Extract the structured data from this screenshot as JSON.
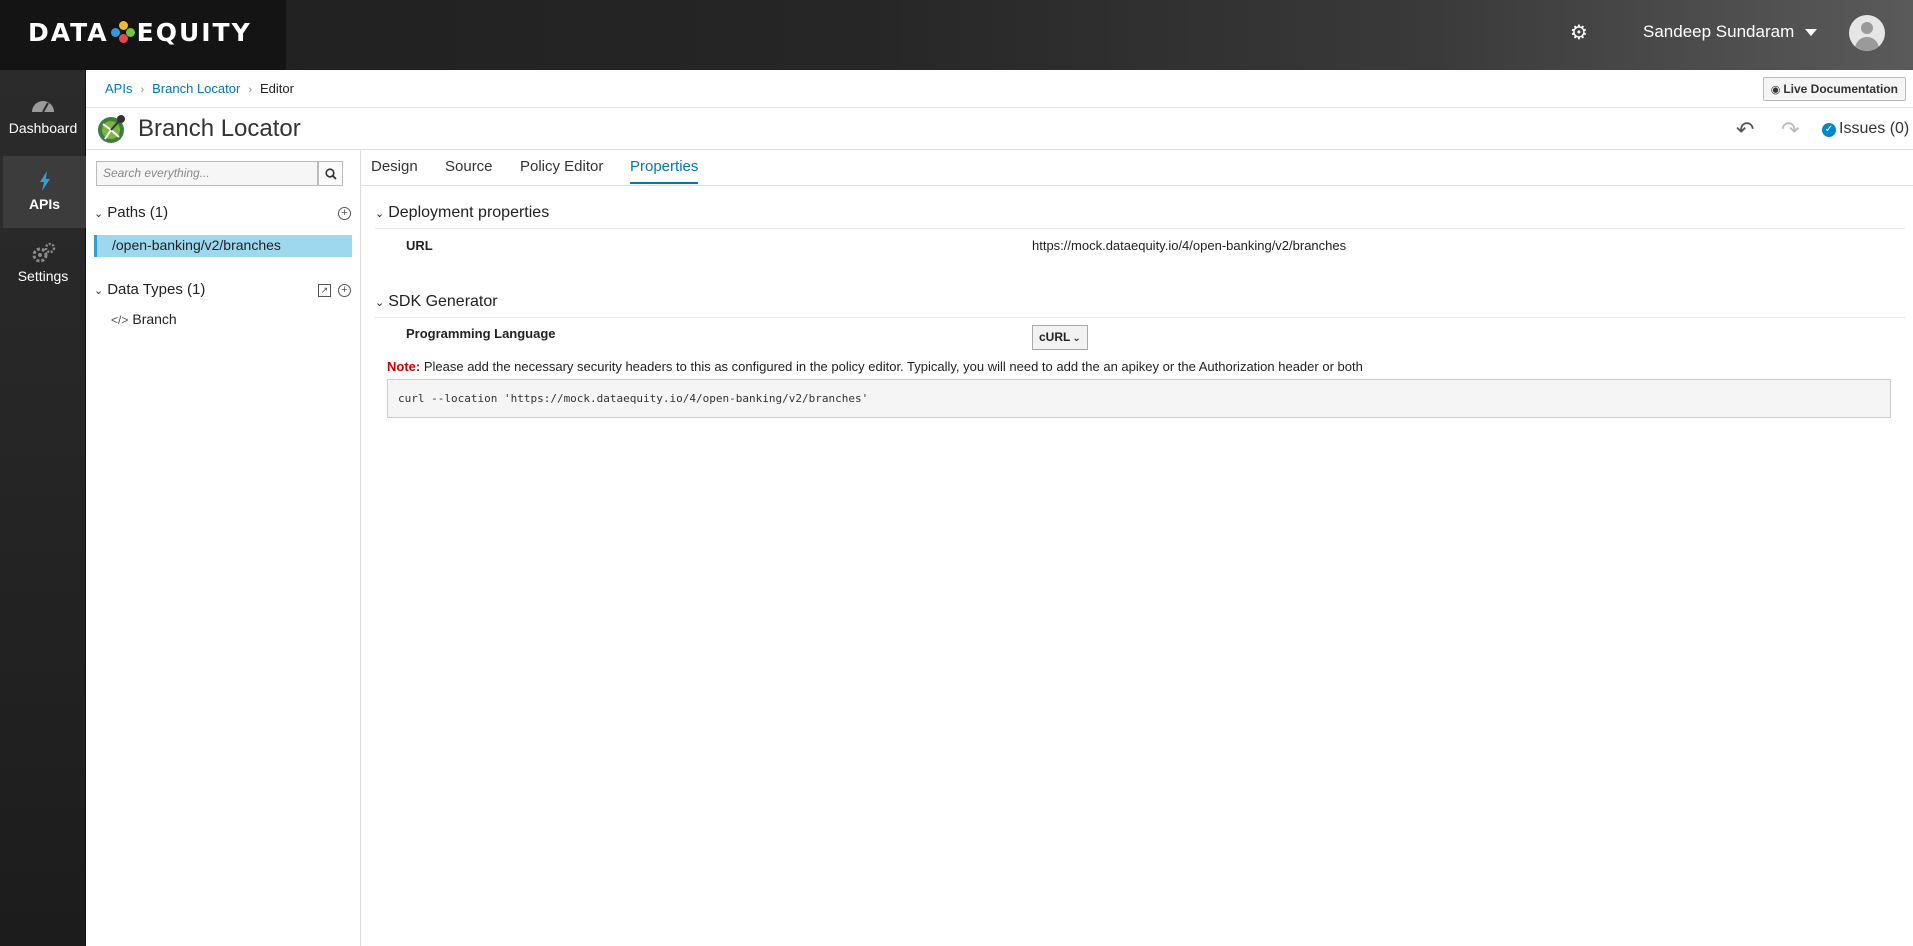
{
  "header": {
    "logo_left": "DATA",
    "logo_right": "EQUITY",
    "user_name": "Sandeep Sundaram"
  },
  "nav": {
    "items": [
      {
        "label": "Dashboard",
        "icon": "dashboard-icon"
      },
      {
        "label": "APIs",
        "icon": "bolt-icon"
      },
      {
        "label": "Settings",
        "icon": "gears-icon"
      }
    ]
  },
  "breadcrumb": {
    "items": [
      "APIs",
      "Branch Locator",
      "Editor"
    ],
    "live_doc_label": "Live Documentation"
  },
  "title": {
    "api_name": "Branch Locator",
    "issues_label": "Issues (0)"
  },
  "sidebar": {
    "search_placeholder": "Search everything...",
    "paths_header": "Paths (1)",
    "paths": [
      "/open-banking/v2/branches"
    ],
    "types_header": "Data Types (1)",
    "types": [
      "Branch"
    ]
  },
  "tabs": [
    "Design",
    "Source",
    "Policy Editor",
    "Properties"
  ],
  "active_tab": "Properties",
  "deployment": {
    "title": "Deployment properties",
    "url_label": "URL",
    "url_value": "https://mock.dataequity.io/4/open-banking/v2/branches"
  },
  "sdk": {
    "title": "SDK Generator",
    "lang_label": "Programming Language",
    "lang_value": "cURL",
    "note_prefix": "Note:",
    "note_text": " Please add the necessary security headers to this as configured in the policy editor. Typically, you will need to add the an apikey or the Authorization header or both",
    "code": "curl --location 'https://mock.dataequity.io/4/open-banking/v2/branches'"
  },
  "colors": {
    "accent": "#0077b6",
    "selected_path": "#9dd8ee",
    "note_red": "#cc0000"
  }
}
